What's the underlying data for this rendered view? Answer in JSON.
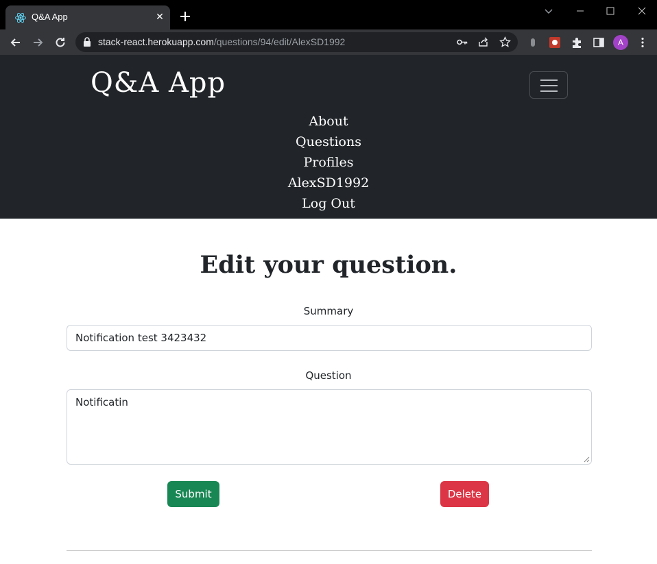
{
  "browser": {
    "tab_title": "Q&A App",
    "url_host": "stack-react.herokuapp.com",
    "url_path": "/questions/94/edit/AlexSD1992",
    "profile_initial": "A"
  },
  "navbar": {
    "brand": "Q&A App",
    "links": [
      "About",
      "Questions",
      "Profiles",
      "AlexSD1992",
      "Log Out"
    ]
  },
  "form": {
    "heading": "Edit your question.",
    "summary_label": "Summary",
    "summary_value": "Notification test 3423432",
    "question_label": "Question",
    "question_value": "Notificatin",
    "submit_label": "Submit",
    "delete_label": "Delete"
  },
  "colors": {
    "navbar_bg": "#212529",
    "submit": "#198754",
    "delete": "#dc3545"
  }
}
